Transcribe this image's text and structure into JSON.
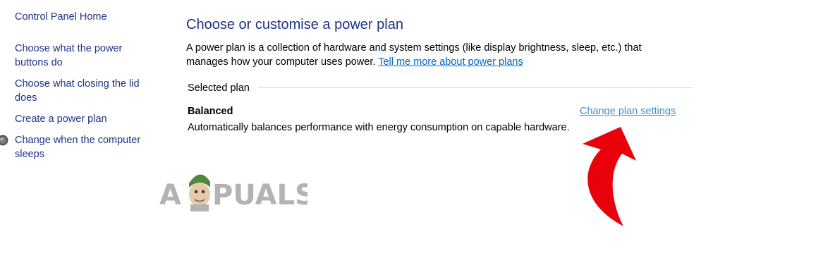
{
  "sidebar": {
    "home": "Control Panel Home",
    "items": [
      {
        "label": "Choose what the power buttons do"
      },
      {
        "label": "Choose what closing the lid does"
      },
      {
        "label": "Create a power plan"
      },
      {
        "label": "Change when the computer sleeps",
        "icon": "shield-icon"
      }
    ]
  },
  "main": {
    "title": "Choose or customise a power plan",
    "description": "A power plan is a collection of hardware and system settings (like display brightness, sleep, etc.) that manages how your computer uses power.",
    "learn_more_link": "Tell me more about power plans",
    "section_label": "Selected plan",
    "plan": {
      "name": "Balanced",
      "change_link": "Change plan settings",
      "description": "Automatically balances performance with energy consumption on capable hardware."
    }
  },
  "watermark": {
    "text": "APPUALS"
  },
  "colors": {
    "link_dark": "#1e3287",
    "link_blue": "#3c8fd6",
    "annotation_arrow": "#e8000b"
  }
}
